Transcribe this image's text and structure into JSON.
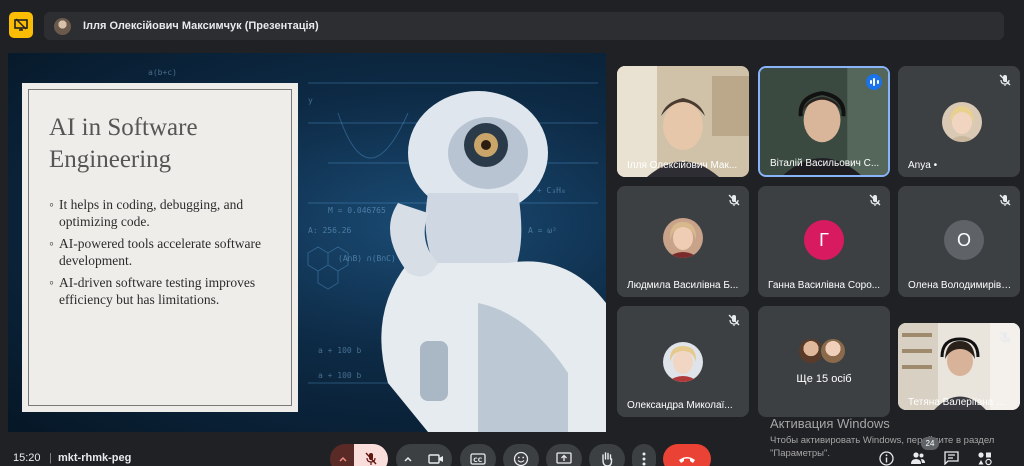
{
  "top_bar": {
    "presenter_label": "Ілля Олексійович Максимчук (Презентація)"
  },
  "slide": {
    "title": "AI in Software Engineering",
    "bullet_marker": "◦",
    "bullets": [
      "It helps in coding, debugging, and optimizing code.",
      "AI-powered tools accelerate software development.",
      "AI-driven software testing improves efficiency but has limitations."
    ]
  },
  "participants": [
    {
      "name": "Ілля Олексійович Мак...",
      "kind": "video",
      "mic_off": false,
      "speaking": false
    },
    {
      "name": "Віталій Васильович С...",
      "kind": "video",
      "mic_off": false,
      "speaking": true
    },
    {
      "name": "Anya •",
      "kind": "photo",
      "mic_off": true,
      "speaking": false
    },
    {
      "name": "Людмила Василівна Б...",
      "kind": "photo",
      "mic_off": true,
      "speaking": false
    },
    {
      "name": "Ганна Василівна Соро...",
      "kind": "letter",
      "letter": "Г",
      "color": "#d81b60",
      "mic_off": true,
      "speaking": false
    },
    {
      "name": "Олена Володимирівн...",
      "kind": "letter",
      "letter": "О",
      "color": "#5f6368",
      "mic_off": true,
      "speaking": false
    },
    {
      "name": "Олександра Миколаї...",
      "kind": "photo",
      "mic_off": true,
      "speaking": false
    },
    {
      "name": "Ще 15 осіб",
      "kind": "more",
      "mic_off": false,
      "speaking": false
    },
    {
      "name": "Тетяна Валеріївна Шу...",
      "kind": "video",
      "mic_off": true,
      "speaking": false
    }
  ],
  "watermark": {
    "title": "Активация Windows",
    "subtitle": "Чтобы активировать Windows, перейдите в раздел \"Параметры\"."
  },
  "bottom_bar": {
    "time": "15:20",
    "separator": "|",
    "meeting_code": "mkt-rhmk-peg",
    "participant_count": "24"
  },
  "colors": {
    "accent_blue": "#8ab4f8",
    "present_yellow": "#fbbc04",
    "end_call_red": "#ea4335"
  },
  "icons": {
    "present": "present-icon",
    "mic_off": "mic-off-icon",
    "camera": "camera-icon",
    "captions": "captions-icon",
    "emoji": "emoji-icon",
    "share": "share-screen-icon",
    "hand": "raise-hand-icon",
    "more": "more-options-icon",
    "hangup": "hang-up-icon",
    "info": "info-icon",
    "people": "people-icon",
    "chat": "chat-icon",
    "activities": "activities-icon"
  }
}
